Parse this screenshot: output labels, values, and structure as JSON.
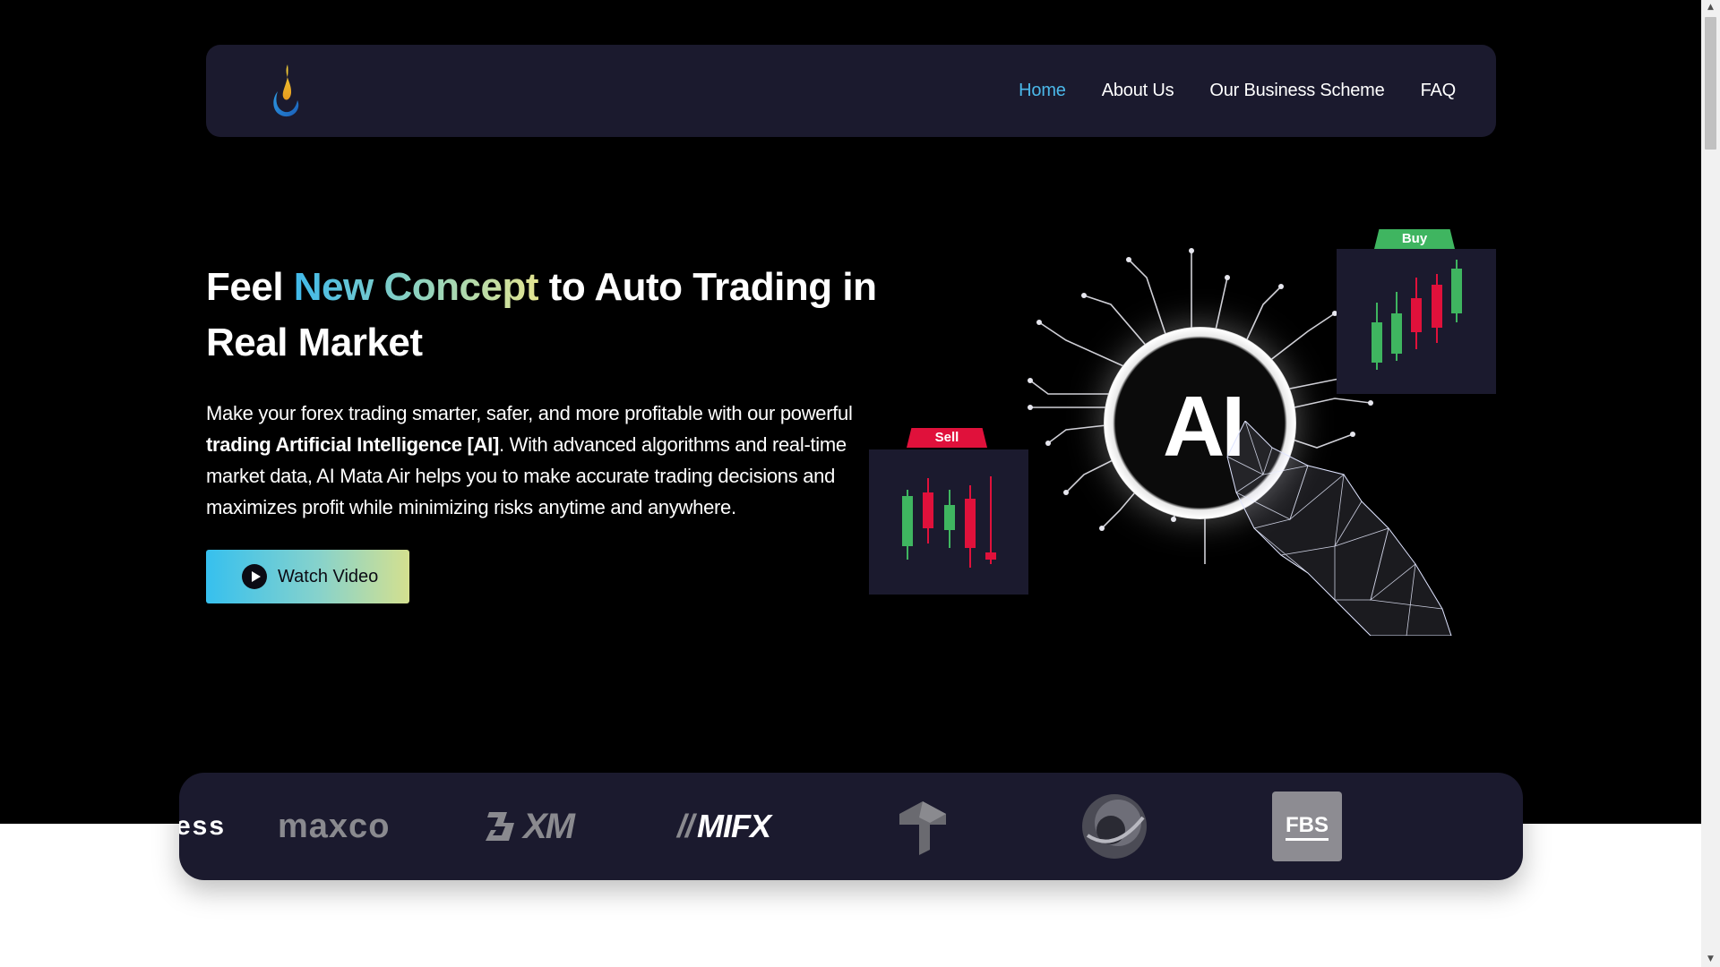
{
  "nav": {
    "logo_icon": "flame-drop-logo",
    "links": [
      {
        "label": "Home",
        "active": true
      },
      {
        "label": "About Us",
        "active": false
      },
      {
        "label": "Our Business Scheme",
        "active": false
      },
      {
        "label": "FAQ",
        "active": false
      }
    ]
  },
  "hero": {
    "title_part1": "Feel ",
    "title_highlight": "New Concept",
    "title_part2": " to Auto Trading in Real Market",
    "desc_part1": "Make your forex trading smarter, safer, and more profitable with our powerful ",
    "desc_bold": "trading Artificial Intelligence [AI]",
    "desc_part2": ". With advanced algorithms and real-time market data, AI Mata Air helps you to make accurate trading decisions and maximizes profit while minimizing risks anytime and anywhere.",
    "cta_label": "Watch Video",
    "cta_icon": "play-icon"
  },
  "illustration": {
    "center_label": "AI",
    "sell_tag": "Sell",
    "buy_tag": "Buy"
  },
  "brokers": {
    "partial_label": "ess",
    "items": [
      {
        "name": "maxco"
      },
      {
        "name": "XM"
      },
      {
        "name": "MIFX"
      },
      {
        "name": "tp-logo"
      },
      {
        "name": "globe-logo"
      },
      {
        "name": "FBS"
      }
    ]
  },
  "colors": {
    "background": "#000000",
    "panel": "#1b1a2e",
    "accent": "#4bb8e9",
    "sell": "#e0113b",
    "buy": "#3fb560"
  }
}
